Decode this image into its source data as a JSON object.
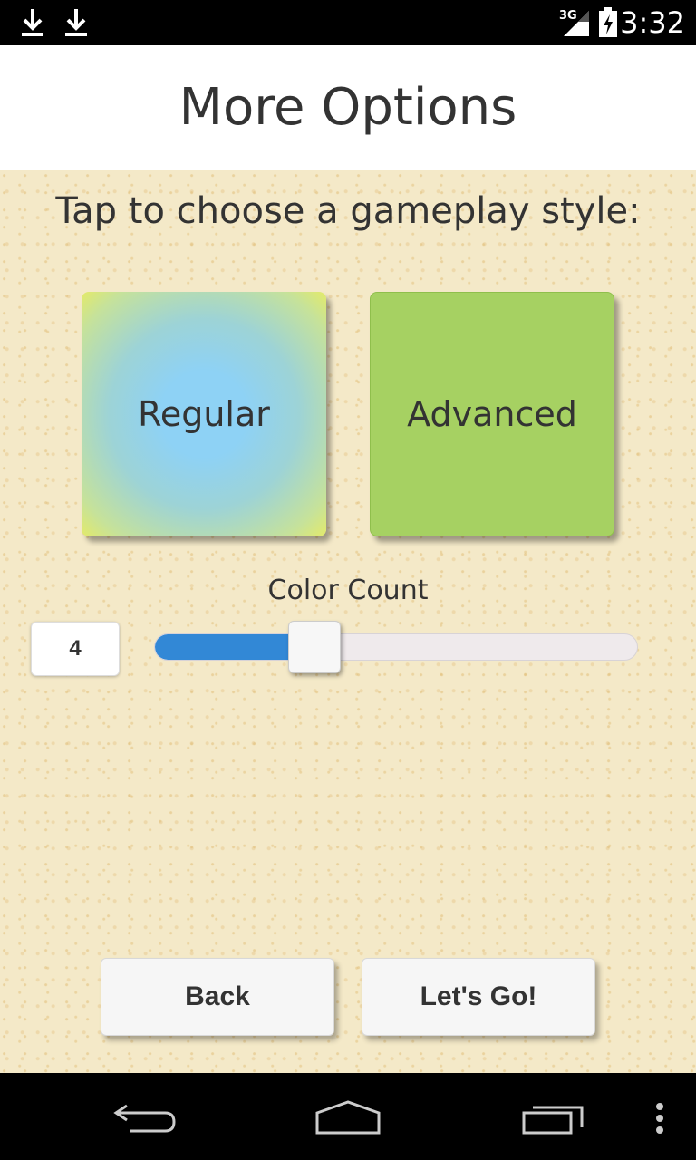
{
  "status_bar": {
    "time": "3:32",
    "network": "3G",
    "icons": [
      "download-icon",
      "download-icon",
      "signal-icon",
      "battery-charging-icon"
    ]
  },
  "header": {
    "title": "More Options"
  },
  "main": {
    "prompt": "Tap to choose a gameplay style:",
    "styles": [
      {
        "label": "Regular",
        "color": "#8ed2f5"
      },
      {
        "label": "Advanced",
        "color": "#a6d162"
      }
    ],
    "color_count": {
      "label": "Color Count",
      "value": "4",
      "slider_fraction": 0.29,
      "slider_color": "#3288d6"
    }
  },
  "buttons": {
    "back": "Back",
    "go": "Let's Go!"
  },
  "nav_bar": {
    "icons": [
      "back-nav-icon",
      "home-nav-icon",
      "recent-apps-icon",
      "overflow-menu-icon"
    ]
  }
}
